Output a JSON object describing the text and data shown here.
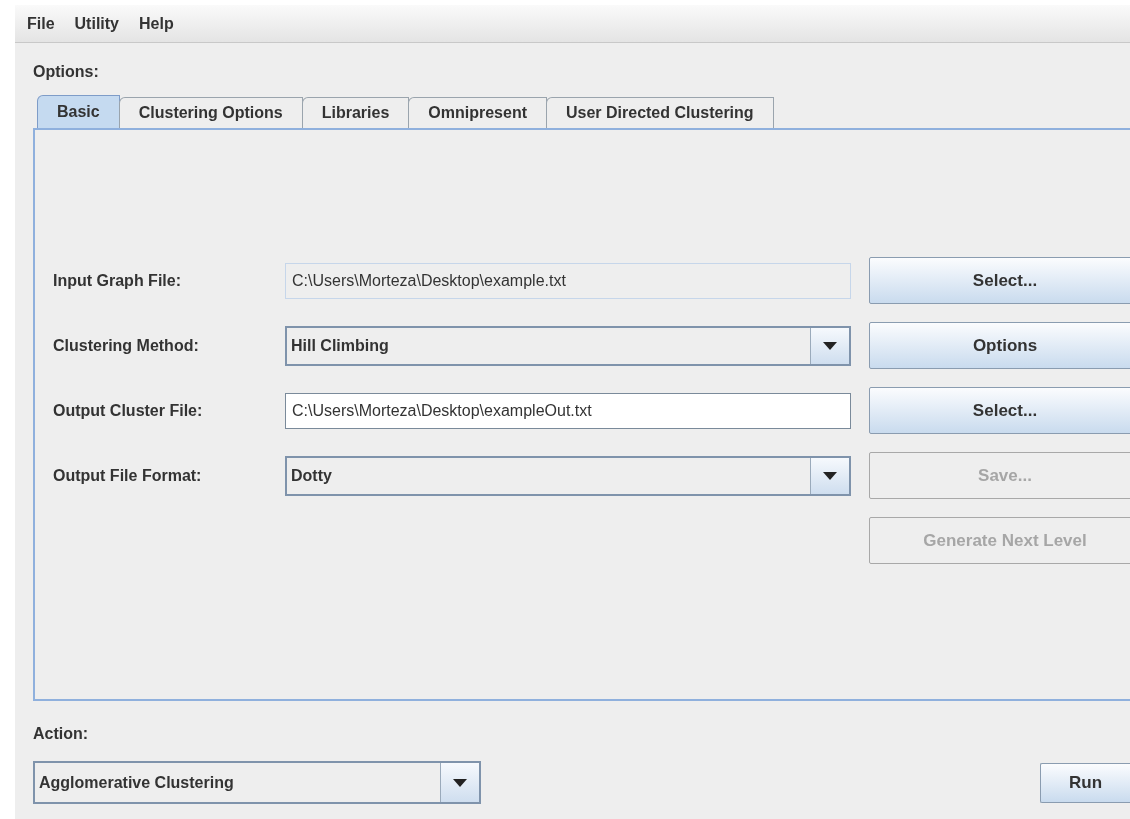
{
  "menu": [
    "File",
    "Utility",
    "Help"
  ],
  "options_label": "Options:",
  "tabs": [
    {
      "label": "Basic",
      "selected": true
    },
    {
      "label": "Clustering Options",
      "selected": false
    },
    {
      "label": "Libraries",
      "selected": false
    },
    {
      "label": "Omnipresent",
      "selected": false
    },
    {
      "label": "User Directed Clustering",
      "selected": false
    }
  ],
  "rows": [
    {
      "label": "Input Graph File:",
      "kind": "text",
      "value": "C:\\Users\\Morteza\\Desktop\\example.txt",
      "editable": false,
      "button": {
        "label": "Select...",
        "disabled": false
      }
    },
    {
      "label": "Clustering Method:",
      "kind": "combo",
      "value": "Hill Climbing",
      "button": {
        "label": "Options",
        "disabled": false
      }
    },
    {
      "label": "Output Cluster File:",
      "kind": "text",
      "value": "C:\\Users\\Morteza\\Desktop\\exampleOut.txt",
      "editable": true,
      "button": {
        "label": "Select...",
        "disabled": false
      }
    },
    {
      "label": "Output File Format:",
      "kind": "combo",
      "value": "Dotty",
      "button": {
        "label": "Save...",
        "disabled": true
      }
    }
  ],
  "extra_button": {
    "label": "Generate Next Level",
    "disabled": true
  },
  "action_label": "Action:",
  "action": {
    "value": "Agglomerative Clustering"
  },
  "run_button": {
    "label": "Run",
    "disabled": false
  }
}
